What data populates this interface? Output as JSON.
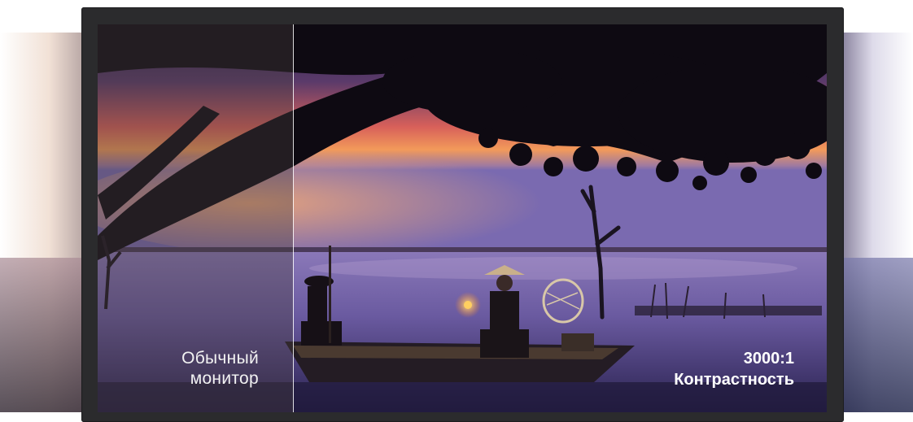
{
  "comparison": {
    "left_label_line1": "Обычный",
    "left_label_line2": "монитор",
    "right_label_line1": "3000:1",
    "right_label_line2": "Контрастность"
  },
  "colors": {
    "monitor_bezel": "#2b2b2d",
    "sky_top": "#3a2a5a",
    "sunset_orange": "#f08a4a",
    "water": "#6a5a9a"
  }
}
